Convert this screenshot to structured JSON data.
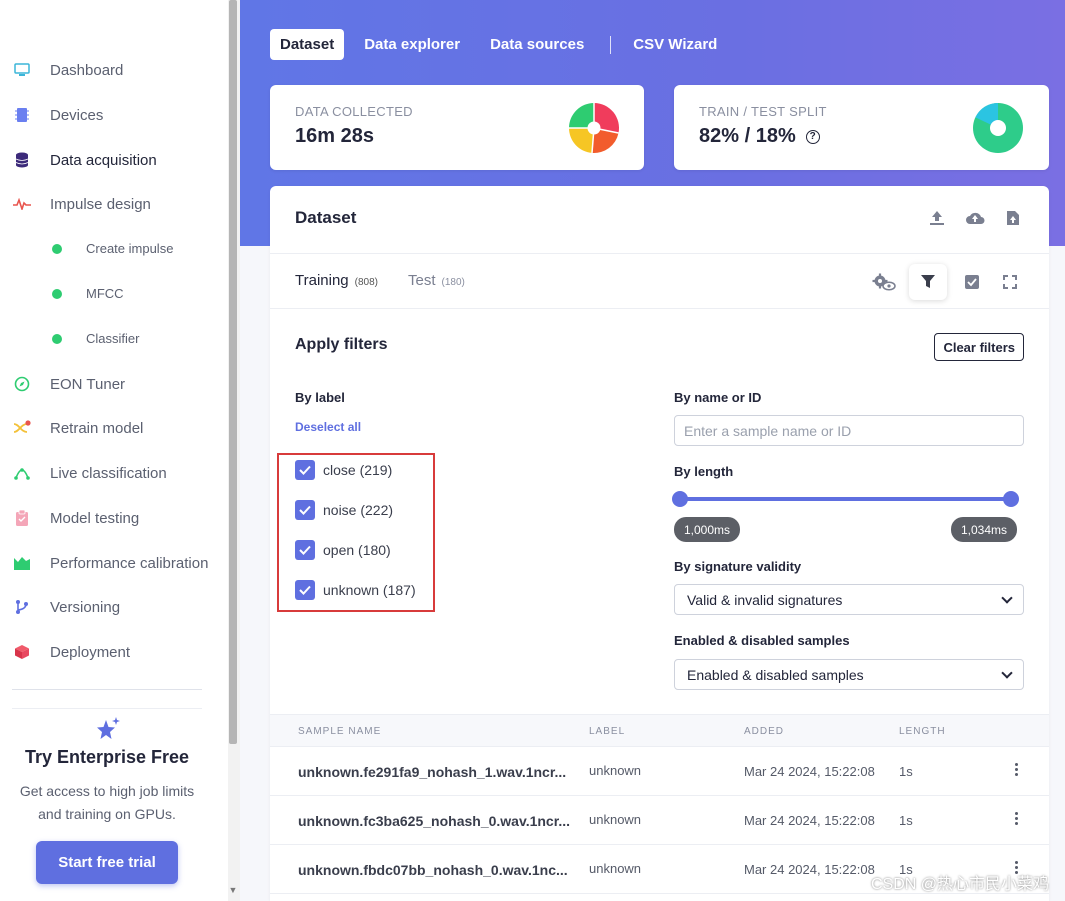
{
  "sidebar": {
    "items": [
      {
        "label": "Dashboard",
        "icon": "monitor-icon"
      },
      {
        "label": "Devices",
        "icon": "chip-icon"
      },
      {
        "label": "Data acquisition",
        "icon": "database-icon"
      },
      {
        "label": "Impulse design",
        "icon": "pulse-icon"
      },
      {
        "label": "Create impulse",
        "icon": "dot-icon"
      },
      {
        "label": "MFCC",
        "icon": "dot-icon"
      },
      {
        "label": "Classifier",
        "icon": "dot-icon"
      },
      {
        "label": "EON Tuner",
        "icon": "compass-icon"
      },
      {
        "label": "Retrain model",
        "icon": "shuffle-icon"
      },
      {
        "label": "Live classification",
        "icon": "signal-icon"
      },
      {
        "label": "Model testing",
        "icon": "clipboard-icon"
      },
      {
        "label": "Performance calibration",
        "icon": "bars-icon"
      },
      {
        "label": "Versioning",
        "icon": "branch-icon"
      },
      {
        "label": "Deployment",
        "icon": "box-icon"
      }
    ],
    "enterprise": {
      "title": "Try Enterprise Free",
      "line1": "Get access to high job limits",
      "line2": "and training on GPUs.",
      "button": "Start free trial"
    }
  },
  "tabs": [
    "Dataset",
    "Data explorer",
    "Data sources",
    "CSV Wizard"
  ],
  "stats": {
    "collected_label": "DATA COLLECTED",
    "collected_value": "16m 28s",
    "split_label": "TRAIN / TEST SPLIT",
    "split_value": "82% / 18%",
    "split_help": "?",
    "split_percent": [
      82,
      18
    ]
  },
  "dataset": {
    "title": "Dataset",
    "training_label": "Training",
    "training_count": "(808)",
    "test_label": "Test",
    "test_count": "(180)"
  },
  "filters": {
    "title": "Apply filters",
    "clear": "Clear filters",
    "by_label": "By label",
    "deselect_all": "Deselect all",
    "labels": [
      "close (219)",
      "noise (222)",
      "open (180)",
      "unknown (187)"
    ],
    "by_name": "By name or ID",
    "name_placeholder": "Enter a sample name or ID",
    "by_length": "By length",
    "length_min": "1,000ms",
    "length_max": "1,034ms",
    "by_signature": "By signature validity",
    "signature_value": "Valid & invalid signatures",
    "by_enabled": "Enabled & disabled samples",
    "enabled_value": "Enabled & disabled samples"
  },
  "table": {
    "headers": [
      "SAMPLE NAME",
      "LABEL",
      "ADDED",
      "LENGTH"
    ],
    "rows": [
      {
        "name": "unknown.fe291fa9_nohash_1.wav.1ncr...",
        "label": "unknown",
        "added": "Mar 24 2024, 15:22:08",
        "length": "1s"
      },
      {
        "name": "unknown.fc3ba625_nohash_0.wav.1ncr...",
        "label": "unknown",
        "added": "Mar 24 2024, 15:22:08",
        "length": "1s"
      },
      {
        "name": "unknown.fbdc07bb_nohash_0.wav.1nc...",
        "label": "unknown",
        "added": "Mar 24 2024, 15:22:08",
        "length": "1s"
      }
    ]
  },
  "watermark": "CSDN @热心市民小菜鸡",
  "colors": {
    "accent": "#5f6fe0",
    "highlight_box": "#d83b3b"
  }
}
